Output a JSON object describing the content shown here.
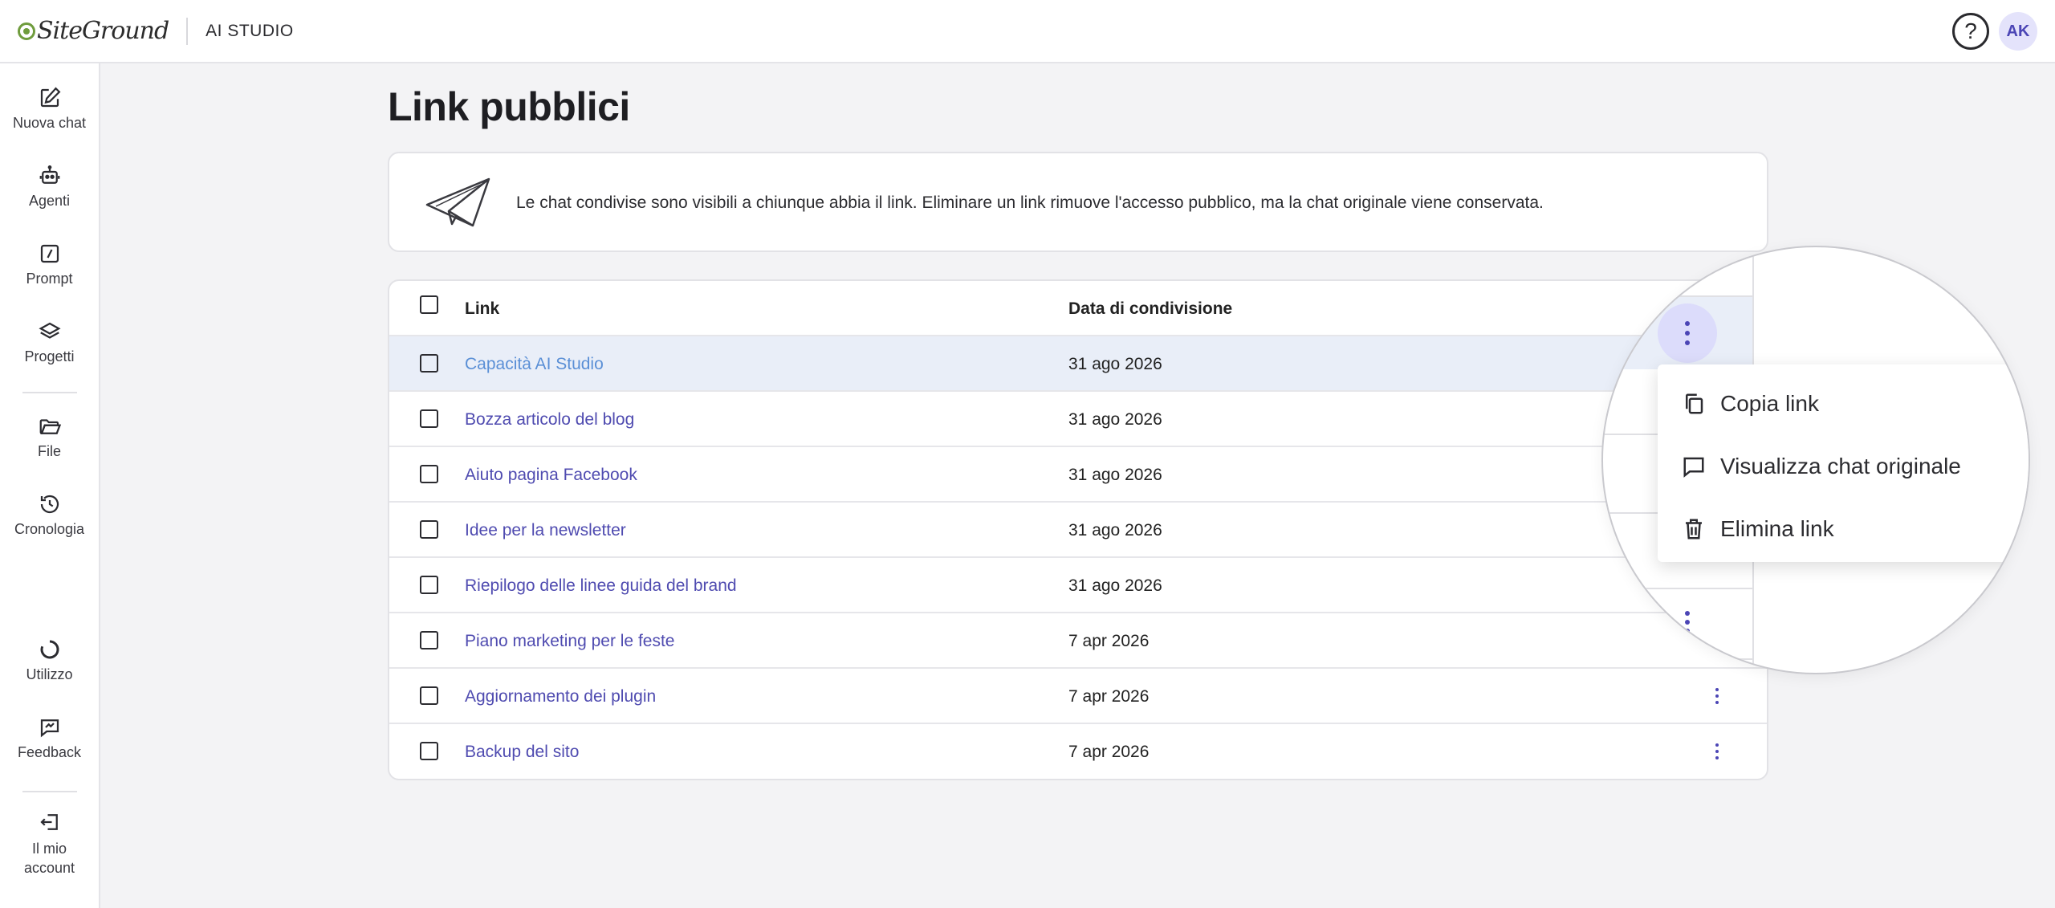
{
  "header": {
    "logo_text": "SiteGround",
    "app_title": "AI STUDIO",
    "help_symbol": "?",
    "avatar_initials": "AK"
  },
  "sidebar": {
    "items": [
      {
        "label": "Nuova chat",
        "icon": "edit-icon"
      },
      {
        "label": "Agenti",
        "icon": "robot-icon"
      },
      {
        "label": "Prompt",
        "icon": "prompt-icon"
      },
      {
        "label": "Progetti",
        "icon": "layers-icon"
      },
      {
        "label": "File",
        "icon": "folder-icon"
      },
      {
        "label": "Cronologia",
        "icon": "history-icon"
      },
      {
        "label": "Utilizzo",
        "icon": "usage-icon"
      },
      {
        "label": "Feedback",
        "icon": "feedback-icon"
      },
      {
        "label": "Il mio account",
        "icon": "logout-icon"
      }
    ]
  },
  "page": {
    "title": "Link pubblici",
    "info_text": "Le chat condivise sono visibili a chiunque abbia il link. Eliminare un link rimuove l'accesso pubblico, ma la chat originale viene conservata."
  },
  "table": {
    "columns": {
      "link": "Link",
      "date": "Data di condivisione"
    },
    "rows": [
      {
        "link": "Capacità AI Studio",
        "date": "31 ago 2026",
        "selected": true
      },
      {
        "link": "Bozza articolo del blog",
        "date": "31 ago 2026"
      },
      {
        "link": "Aiuto pagina Facebook",
        "date": "31 ago 2026"
      },
      {
        "link": "Idee per la newsletter",
        "date": "31 ago 2026"
      },
      {
        "link": "Riepilogo delle linee guida del brand",
        "date": "31 ago 2026"
      },
      {
        "link": "Piano marketing per le feste",
        "date": "7 apr 2026"
      },
      {
        "link": "Aggiornamento dei plugin",
        "date": "7 apr 2026"
      },
      {
        "link": "Backup del sito",
        "date": "7 apr 2026"
      }
    ]
  },
  "context_menu": {
    "items": [
      {
        "label": "Copia link",
        "icon": "copy-icon"
      },
      {
        "label": "Visualizza chat originale",
        "icon": "chat-bubble-icon"
      },
      {
        "label": "Elimina link",
        "icon": "trash-icon"
      }
    ]
  },
  "colors": {
    "accent": "#4b45b5",
    "link": "#4f4bb0",
    "selected_row": "#e9eef8",
    "brand_green": "#6f9c3d"
  }
}
